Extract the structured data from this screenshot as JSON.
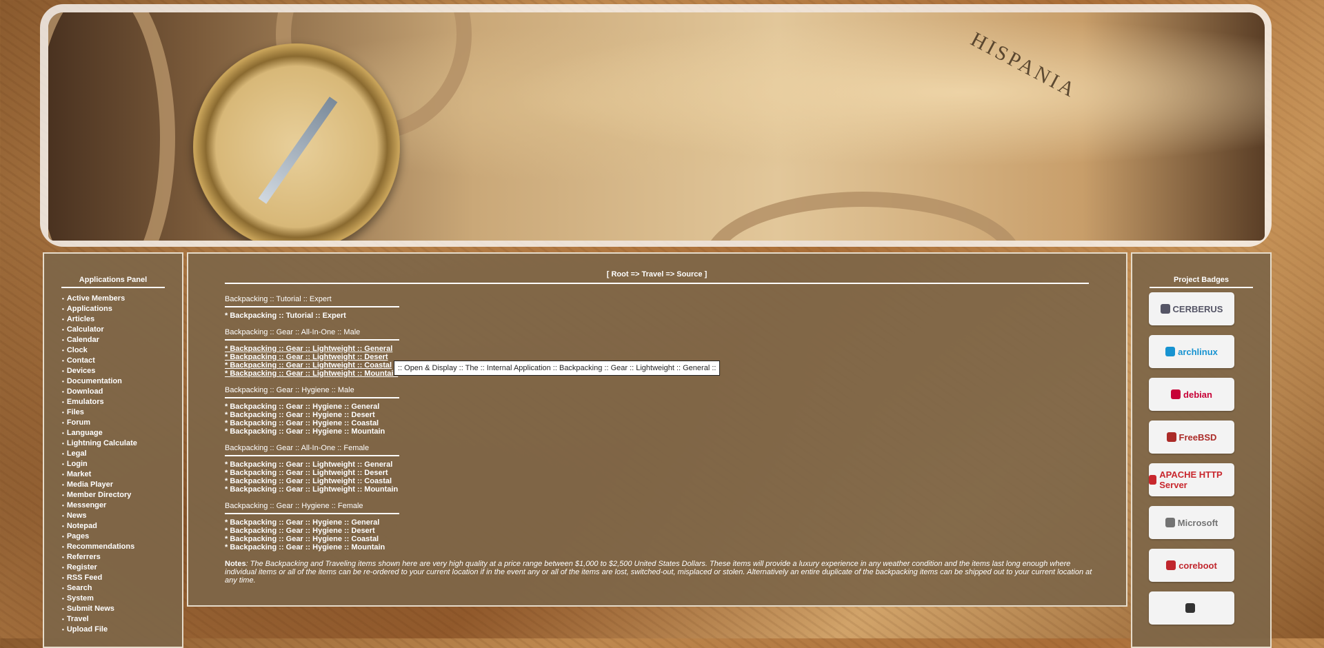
{
  "left_panel": {
    "title": "Applications Panel",
    "items": [
      "Active Members",
      "Applications",
      "Articles",
      "Calculator",
      "Calendar",
      "Clock",
      "Contact",
      "Devices",
      "Documentation",
      "Download",
      "Emulators",
      "Files",
      "Forum",
      "Language",
      "Lightning Calculate",
      "Legal",
      "Login",
      "Market",
      "Media Player",
      "Member Directory",
      "Messenger",
      "News",
      "Notepad",
      "Pages",
      "Recommendations",
      "Referrers",
      "Register",
      "RSS Feed",
      "Search",
      "System",
      "Submit News",
      "Travel",
      "Upload File"
    ]
  },
  "path": "[ Root => Travel => Source ]",
  "sections": [
    {
      "heading": "Backpacking :: Tutorial :: Expert",
      "items": [
        "* Backpacking :: Tutorial :: Expert"
      ],
      "underlined": false
    },
    {
      "heading": "Backpacking :: Gear :: All-In-One :: Male",
      "items": [
        "* Backpacking :: Gear :: Lightweight :: General",
        "* Backpacking :: Gear :: Lightweight :: Desert",
        "* Backpacking :: Gear :: Lightweight :: Coastal",
        "* Backpacking :: Gear :: Lightweight :: Mountain"
      ],
      "underlined": true
    },
    {
      "heading": "Backpacking :: Gear :: Hygiene :: Male",
      "items": [
        "* Backpacking :: Gear :: Hygiene :: General",
        "* Backpacking :: Gear :: Hygiene :: Desert",
        "* Backpacking :: Gear :: Hygiene :: Coastal",
        "* Backpacking :: Gear :: Hygiene :: Mountain"
      ],
      "underlined": false
    },
    {
      "heading": "Backpacking :: Gear :: All-In-One :: Female",
      "items": [
        "* Backpacking :: Gear :: Lightweight :: General",
        "* Backpacking :: Gear :: Lightweight :: Desert",
        "* Backpacking :: Gear :: Lightweight :: Coastal",
        "* Backpacking :: Gear :: Lightweight :: Mountain"
      ],
      "underlined": false
    },
    {
      "heading": "Backpacking :: Gear :: Hygiene :: Female",
      "items": [
        "* Backpacking :: Gear :: Hygiene :: General",
        "* Backpacking :: Gear :: Hygiene :: Desert",
        "* Backpacking :: Gear :: Hygiene :: Coastal",
        "* Backpacking :: Gear :: Hygiene :: Mountain"
      ],
      "underlined": false
    }
  ],
  "notes": {
    "label": "Notes",
    "text": ": The Backpacking and Traveling items shown here are very high quality at a price range between $1,000 to $2,500 United States Dollars. These items will provide a luxury experience in any weather condition and the items last long enough where individual items or all of the items can be re-ordered to your current location if in the event any or all of the items are lost, switched-out, misplaced or stolen. Alternatively an entire duplicate of the backpacking items can be shipped out to your current location at any time."
  },
  "tooltip": ":: Open & Display :: The :: Internal Application :: Backpacking :: Gear :: Lightweight :: General ::",
  "banner": {
    "map_title": "HISPANIA"
  },
  "right_panel": {
    "title": "Project Badges",
    "badges": [
      {
        "label": "CERBERUS",
        "icon": "cerberus-icon",
        "color": "#556"
      },
      {
        "label": "archlinux",
        "icon": "arch-icon",
        "color": "#1793d1"
      },
      {
        "label": "debian",
        "icon": "debian-swirl-icon",
        "color": "#c70036"
      },
      {
        "label": "FreeBSD",
        "icon": "freebsd-daemon-icon",
        "color": "#ab2b28"
      },
      {
        "label": "APACHE HTTP Server",
        "icon": "apache-feather-icon",
        "color": "#c8272d"
      },
      {
        "label": "Microsoft",
        "icon": "microsoft-icon",
        "color": "#737373"
      },
      {
        "label": "coreboot",
        "icon": "coreboot-icon",
        "color": "#c0262d"
      },
      {
        "label": "",
        "icon": "prompt-icon",
        "color": "#333"
      }
    ]
  }
}
